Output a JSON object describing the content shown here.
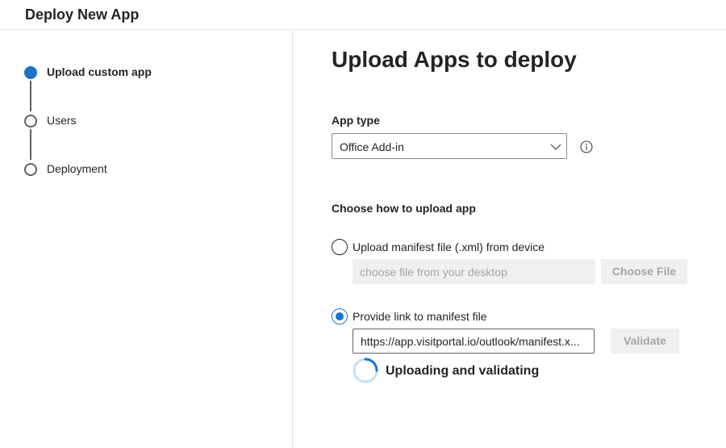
{
  "header": {
    "title": "Deploy New App"
  },
  "stepper": {
    "steps": [
      {
        "label": "Upload custom app",
        "state": "active"
      },
      {
        "label": "Users",
        "state": "pending"
      },
      {
        "label": "Deployment",
        "state": "pending"
      }
    ]
  },
  "main": {
    "title": "Upload Apps to deploy",
    "app_type": {
      "label": "App type",
      "selected": "Office Add-in",
      "icons": {
        "chevron": "chevron-down-icon",
        "info": "info-icon"
      }
    },
    "upload_section": {
      "label": "Choose how to upload app",
      "option_file": {
        "label": "Upload manifest file (.xml) from device",
        "checked": false,
        "placeholder": "choose file from your desktop",
        "button_label": "Choose File"
      },
      "option_link": {
        "label": "Provide link to manifest file",
        "checked": true,
        "value": "https://app.visitportal.io/outlook/manifest.x...",
        "button_label": "Validate"
      },
      "status": {
        "text": "Uploading and validating",
        "icon": "spinner-icon"
      }
    }
  },
  "colors": {
    "accent": "#1a73c9",
    "text": "#242424",
    "disabled_bg": "#f0f0f0",
    "disabled_text": "#a6a6a6",
    "divider": "#e6e6e6"
  }
}
